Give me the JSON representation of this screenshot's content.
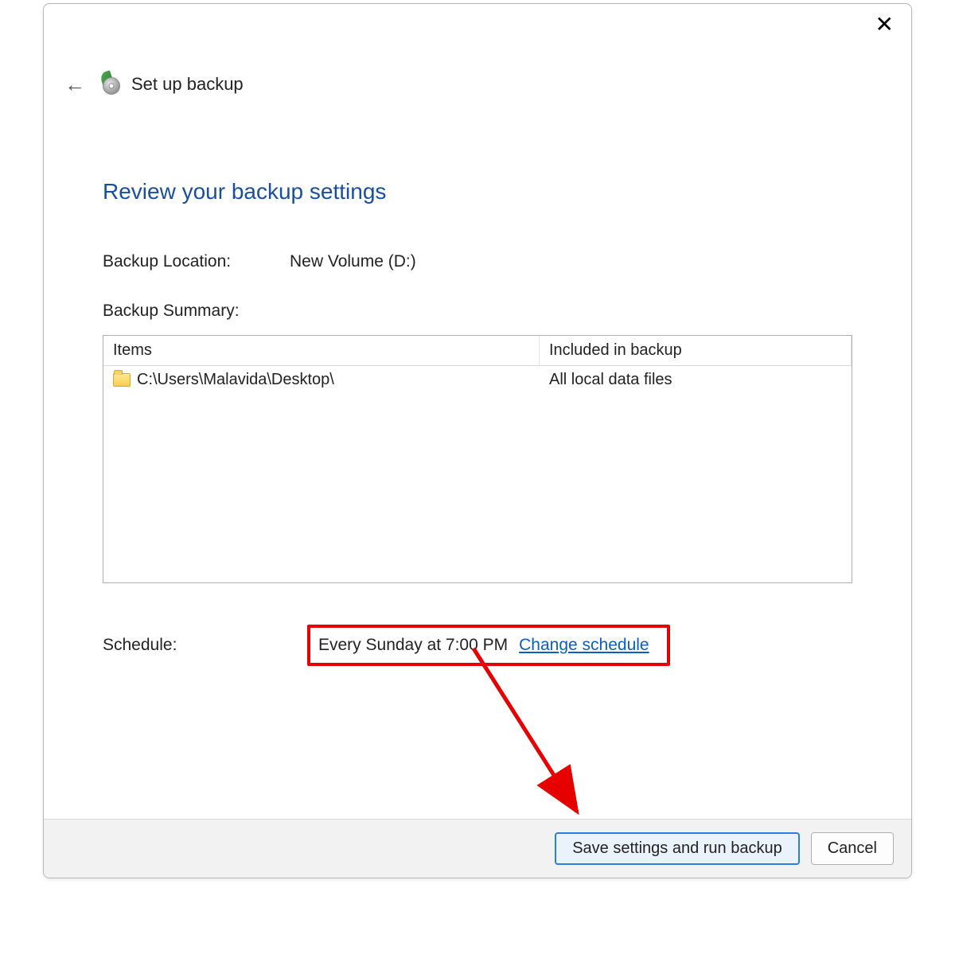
{
  "window": {
    "title": "Set up backup"
  },
  "page": {
    "heading": "Review your backup settings"
  },
  "location": {
    "label": "Backup Location:",
    "value": "New Volume (D:)"
  },
  "summary": {
    "label": "Backup Summary:",
    "columns": {
      "items": "Items",
      "included": "Included in backup"
    },
    "rows": [
      {
        "path": "C:\\Users\\Malavida\\Desktop\\",
        "included": "All local data files"
      }
    ]
  },
  "schedule": {
    "label": "Schedule:",
    "value": "Every Sunday at 7:00 PM",
    "change_link": "Change schedule"
  },
  "footer": {
    "primary": "Save settings and run backup",
    "cancel": "Cancel"
  },
  "annotation": {
    "highlight_color": "#e60000"
  }
}
